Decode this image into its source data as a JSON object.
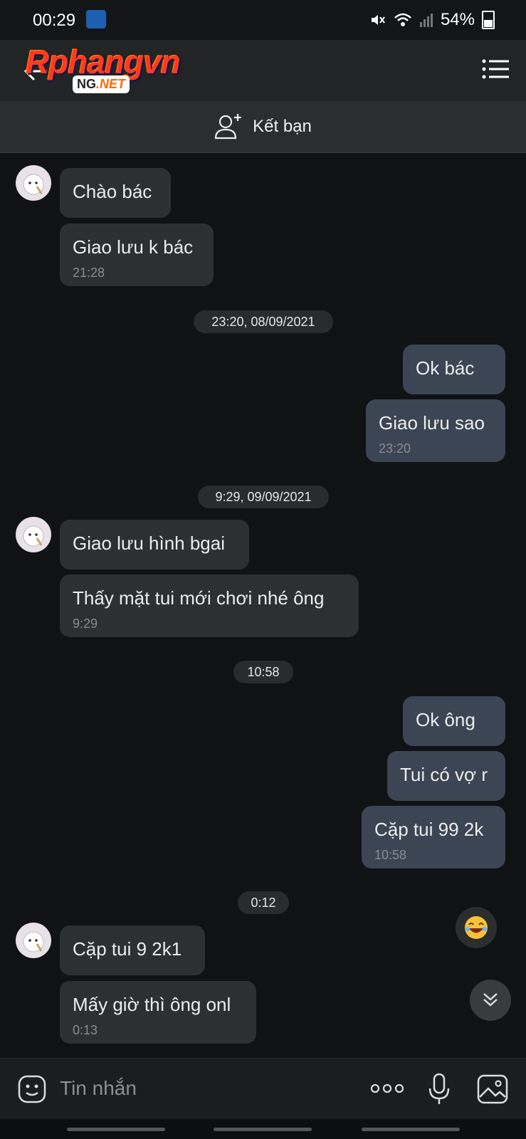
{
  "status": {
    "time": "00:29",
    "battery": "54%"
  },
  "header": {
    "logo_main": "Rphangvn",
    "logo_sub_a": "NG",
    "logo_sub_b": ".NET"
  },
  "add_friend": {
    "label": "Kết bạn"
  },
  "messages": [
    {
      "text": "Chào bác"
    },
    {
      "text": "Giao lưu k bác",
      "time": "21:28"
    },
    {
      "date": "23:20, 08/09/2021"
    },
    {
      "text": "Ok bác"
    },
    {
      "text": "Giao lưu sao",
      "time": "23:20"
    },
    {
      "date": "9:29, 09/09/2021"
    },
    {
      "text": "Giao lưu hình bgai"
    },
    {
      "text": "Thấy mặt tui mới chơi nhé ông",
      "time": "9:29"
    },
    {
      "date": "10:58"
    },
    {
      "text": "Ok ông"
    },
    {
      "text": "Tui có vợ r"
    },
    {
      "text": "Cặp tui 99 2k",
      "time": "10:58"
    },
    {
      "date": "0:12"
    },
    {
      "text": "Cặp tui 9 2k1"
    },
    {
      "text": "Mấy giờ thì ông onl",
      "time": "0:13"
    }
  ],
  "input": {
    "placeholder": "Tin nhắn"
  },
  "colors": {
    "incoming": "#2e2f31",
    "outgoing": "#3c4554",
    "background": "#111213"
  }
}
